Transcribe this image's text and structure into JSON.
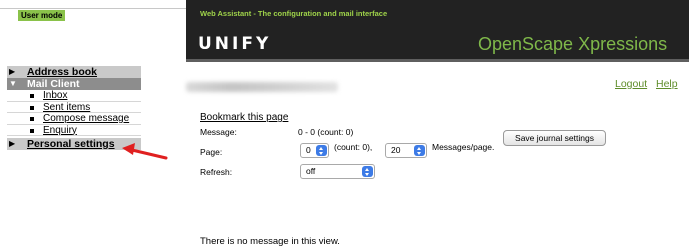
{
  "badge": {
    "user_mode": "User mode"
  },
  "header": {
    "tagline": "Web Assistant - The configuration and mail interface",
    "logo": "UNIFY",
    "product": "OpenScape Xpressions",
    "bg_color": "#222222",
    "accent_color": "#9fd34a"
  },
  "sidebar": {
    "address_book": "Address book",
    "mail_client": "Mail Client",
    "mail_items": [
      "Inbox",
      "Sent items",
      "Compose message",
      "Enquiry"
    ],
    "personal_settings": "Personal settings"
  },
  "top_links": {
    "logout": "Logout",
    "help": "Help"
  },
  "journal": {
    "bookmark": "Bookmark this page",
    "message_label": "Message:",
    "message_value": "0 - 0 (count: 0)",
    "page_label": "Page:",
    "page_value": "0",
    "page_count": "(count: 0),",
    "per_page_value": "20",
    "per_page_suffix": "Messages/page.",
    "refresh_label": "Refresh:",
    "refresh_value": "off",
    "save_button": "Save journal settings"
  },
  "empty_state": "There is no message in this view.",
  "annotation": {
    "arrow_color": "#e02020",
    "arrow_icon": "red-arrow-icon"
  }
}
